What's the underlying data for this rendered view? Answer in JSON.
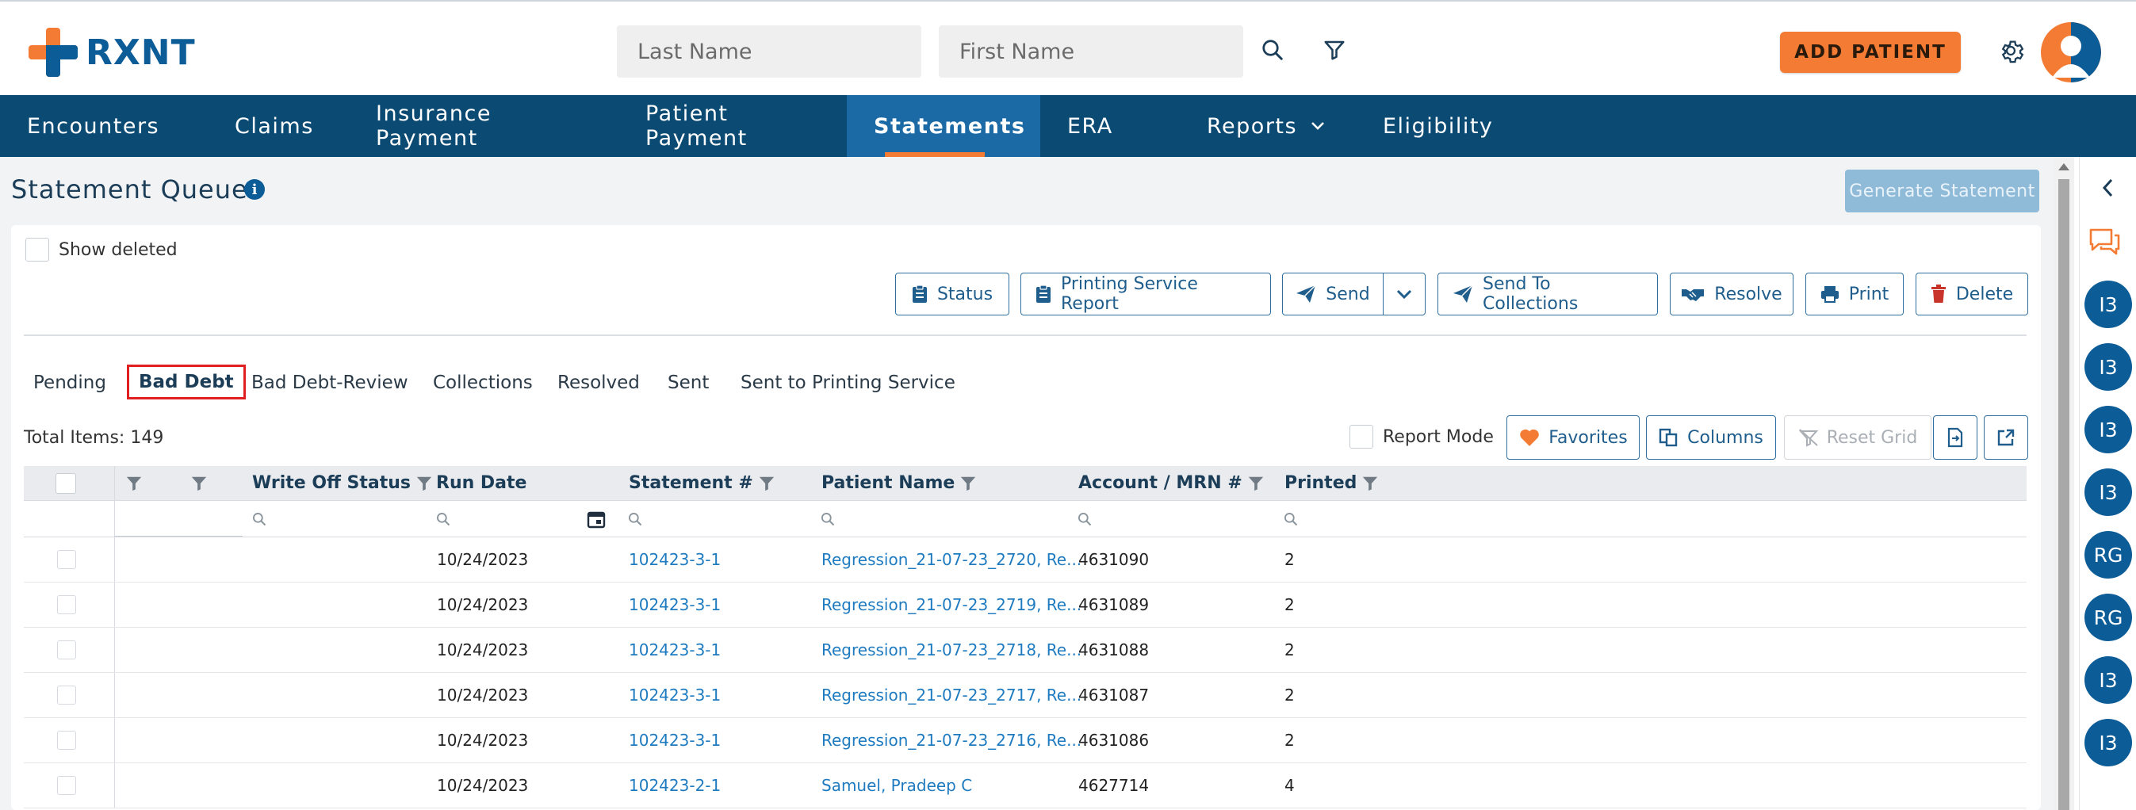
{
  "header": {
    "logo_text": "RXNT",
    "last_name_placeholder": "Last Name",
    "first_name_placeholder": "First Name",
    "add_patient_label": "ADD PATIENT"
  },
  "nav": {
    "items": [
      {
        "label": "Encounters"
      },
      {
        "label": "Claims"
      },
      {
        "label": "Insurance Payment"
      },
      {
        "label": "Patient Payment"
      },
      {
        "label": "Statements",
        "active": true
      },
      {
        "label": "ERA"
      },
      {
        "label": "Reports",
        "dropdown": true
      },
      {
        "label": "Eligibility"
      }
    ]
  },
  "page": {
    "title": "Statement Queue",
    "generate_statement_label": "Generate Statement",
    "show_deleted_label": "Show deleted"
  },
  "toolbar": {
    "status": "Status",
    "printing_service_report": "Printing Service Report",
    "send": "Send",
    "send_to_collections": "Send To Collections",
    "resolve": "Resolve",
    "print": "Print",
    "delete": "Delete"
  },
  "tabs": [
    {
      "label": "Pending"
    },
    {
      "label": "Bad Debt",
      "active": true
    },
    {
      "label": "Bad Debt-Review"
    },
    {
      "label": "Collections"
    },
    {
      "label": "Resolved"
    },
    {
      "label": "Sent"
    },
    {
      "label": "Sent to Printing Service"
    }
  ],
  "grid_tools": {
    "total_items": "Total Items: 149",
    "report_mode": "Report Mode",
    "favorites": "Favorites",
    "columns": "Columns",
    "reset_grid": "Reset Grid"
  },
  "table": {
    "columns": [
      "Write Off Status",
      "Run Date",
      "Statement #",
      "Patient Name",
      "Account / MRN #",
      "Printed"
    ],
    "rows": [
      {
        "run_date": "10/24/2023",
        "statement": "102423-3-1",
        "patient": "Regression_21-07-23_2720, Re...",
        "account": "4631090",
        "printed": "2"
      },
      {
        "run_date": "10/24/2023",
        "statement": "102423-3-1",
        "patient": "Regression_21-07-23_2719, Re...",
        "account": "4631089",
        "printed": "2"
      },
      {
        "run_date": "10/24/2023",
        "statement": "102423-3-1",
        "patient": "Regression_21-07-23_2718, Re...",
        "account": "4631088",
        "printed": "2"
      },
      {
        "run_date": "10/24/2023",
        "statement": "102423-3-1",
        "patient": "Regression_21-07-23_2717, Re...",
        "account": "4631087",
        "printed": "2"
      },
      {
        "run_date": "10/24/2023",
        "statement": "102423-3-1",
        "patient": "Regression_21-07-23_2716, Re...",
        "account": "4631086",
        "printed": "2"
      },
      {
        "run_date": "10/24/2023",
        "statement": "102423-2-1",
        "patient": "Samuel, Pradeep C",
        "account": "4627714",
        "printed": "4"
      }
    ]
  },
  "right_panel": {
    "avatars": [
      "I3",
      "I3",
      "I3",
      "I3",
      "RG",
      "RG",
      "I3",
      "I3"
    ]
  },
  "colors": {
    "brand_orange": "#f47b33",
    "brand_blue": "#0c5c97",
    "nav_bg": "#0b4a73",
    "nav_active": "#1b6aa5",
    "link": "#1f7bc0",
    "highlight": "#e02020"
  }
}
